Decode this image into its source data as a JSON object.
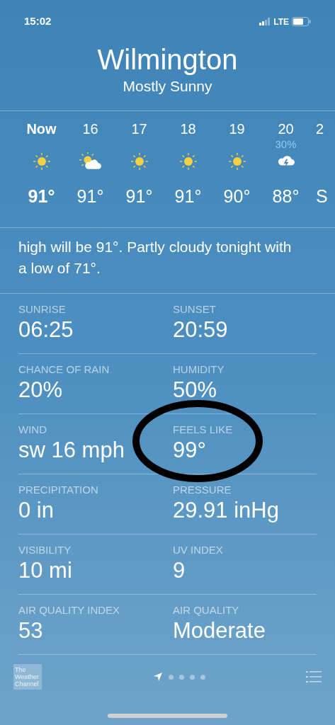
{
  "status_bar": {
    "time": "15:02",
    "network": "LTE"
  },
  "header": {
    "city": "Wilmington",
    "condition": "Mostly Sunny"
  },
  "hourly": [
    {
      "label": "Now",
      "current": true,
      "kind": "sun",
      "temp": "91°"
    },
    {
      "label": "16",
      "current": false,
      "kind": "partly-cloudy",
      "temp": "91°"
    },
    {
      "label": "17",
      "current": false,
      "kind": "sun",
      "temp": "91°"
    },
    {
      "label": "18",
      "current": false,
      "kind": "sun",
      "temp": "91°"
    },
    {
      "label": "19",
      "current": false,
      "kind": "sun",
      "temp": "90°"
    },
    {
      "label": "20",
      "current": false,
      "precip": "30%",
      "kind": "thunderstorm",
      "temp": "88°"
    },
    {
      "label": "2",
      "current": false,
      "temp": "S"
    }
  ],
  "summary": "high will be 91°. Partly cloudy tonight with a low of 71°.",
  "details": [
    {
      "label": "SUNRISE",
      "value": "06:25"
    },
    {
      "label": "SUNSET",
      "value": "20:59"
    },
    {
      "label": "CHANCE OF RAIN",
      "value": "20%"
    },
    {
      "label": "HUMIDITY",
      "value": "50%"
    },
    {
      "label": "WIND",
      "value": "sw 16 mph"
    },
    {
      "label": "FEELS LIKE",
      "value": "99°"
    },
    {
      "label": "PRECIPITATION",
      "value": "0 in"
    },
    {
      "label": "PRESSURE",
      "value": "29.91 inHg"
    },
    {
      "label": "VISIBILITY",
      "value": "10 mi"
    },
    {
      "label": "UV INDEX",
      "value": "9"
    },
    {
      "label": "AIR QUALITY INDEX",
      "value": "53"
    },
    {
      "label": "AIR QUALITY",
      "value": "Moderate"
    }
  ],
  "bottom_bar": {
    "logo_text": "The Weather Channel",
    "pages": [
      {
        "kind": "location",
        "selected": true
      },
      {
        "kind": "dot",
        "selected": false
      },
      {
        "kind": "dot",
        "selected": false
      },
      {
        "kind": "dot",
        "selected": false
      },
      {
        "kind": "dot",
        "selected": false
      }
    ]
  },
  "annotations": [
    {
      "kind": "ellipse"
    }
  ]
}
